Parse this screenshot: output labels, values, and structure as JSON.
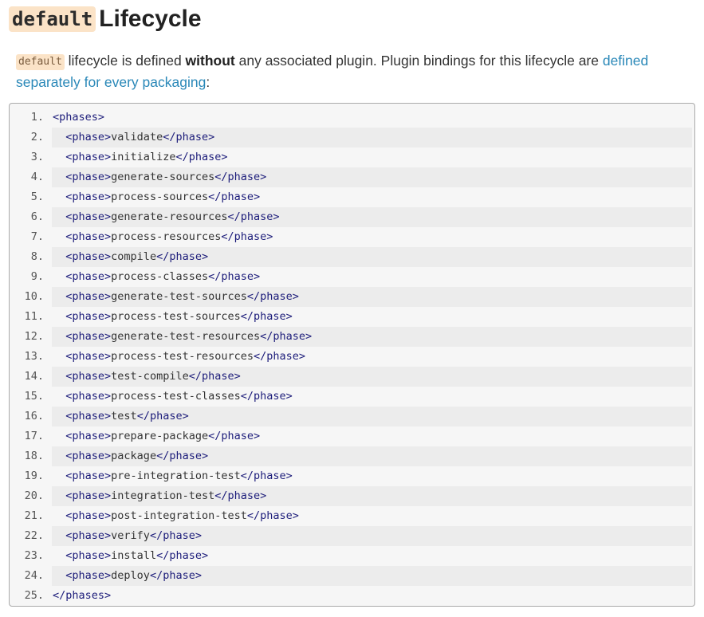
{
  "heading": {
    "code": "default",
    "title": "Lifecycle"
  },
  "intro": {
    "code": "default",
    "text_1": " lifecycle is defined ",
    "bold": "without",
    "text_2": " any associated plugin. Plugin bindings for this lifecycle are ",
    "link": "defined separately for every packaging",
    "text_3": ":"
  },
  "code": {
    "open_tag": "<phases>",
    "close_tag": "</phases>",
    "phase_open": "<phase>",
    "phase_close": "</phase>",
    "phases": [
      "validate",
      "initialize",
      "generate-sources",
      "process-sources",
      "generate-resources",
      "process-resources",
      "compile",
      "process-classes",
      "generate-test-sources",
      "process-test-sources",
      "generate-test-resources",
      "process-test-resources",
      "test-compile",
      "process-test-classes",
      "test",
      "prepare-package",
      "package",
      "pre-integration-test",
      "integration-test",
      "post-integration-test",
      "verify",
      "install",
      "deploy"
    ]
  }
}
